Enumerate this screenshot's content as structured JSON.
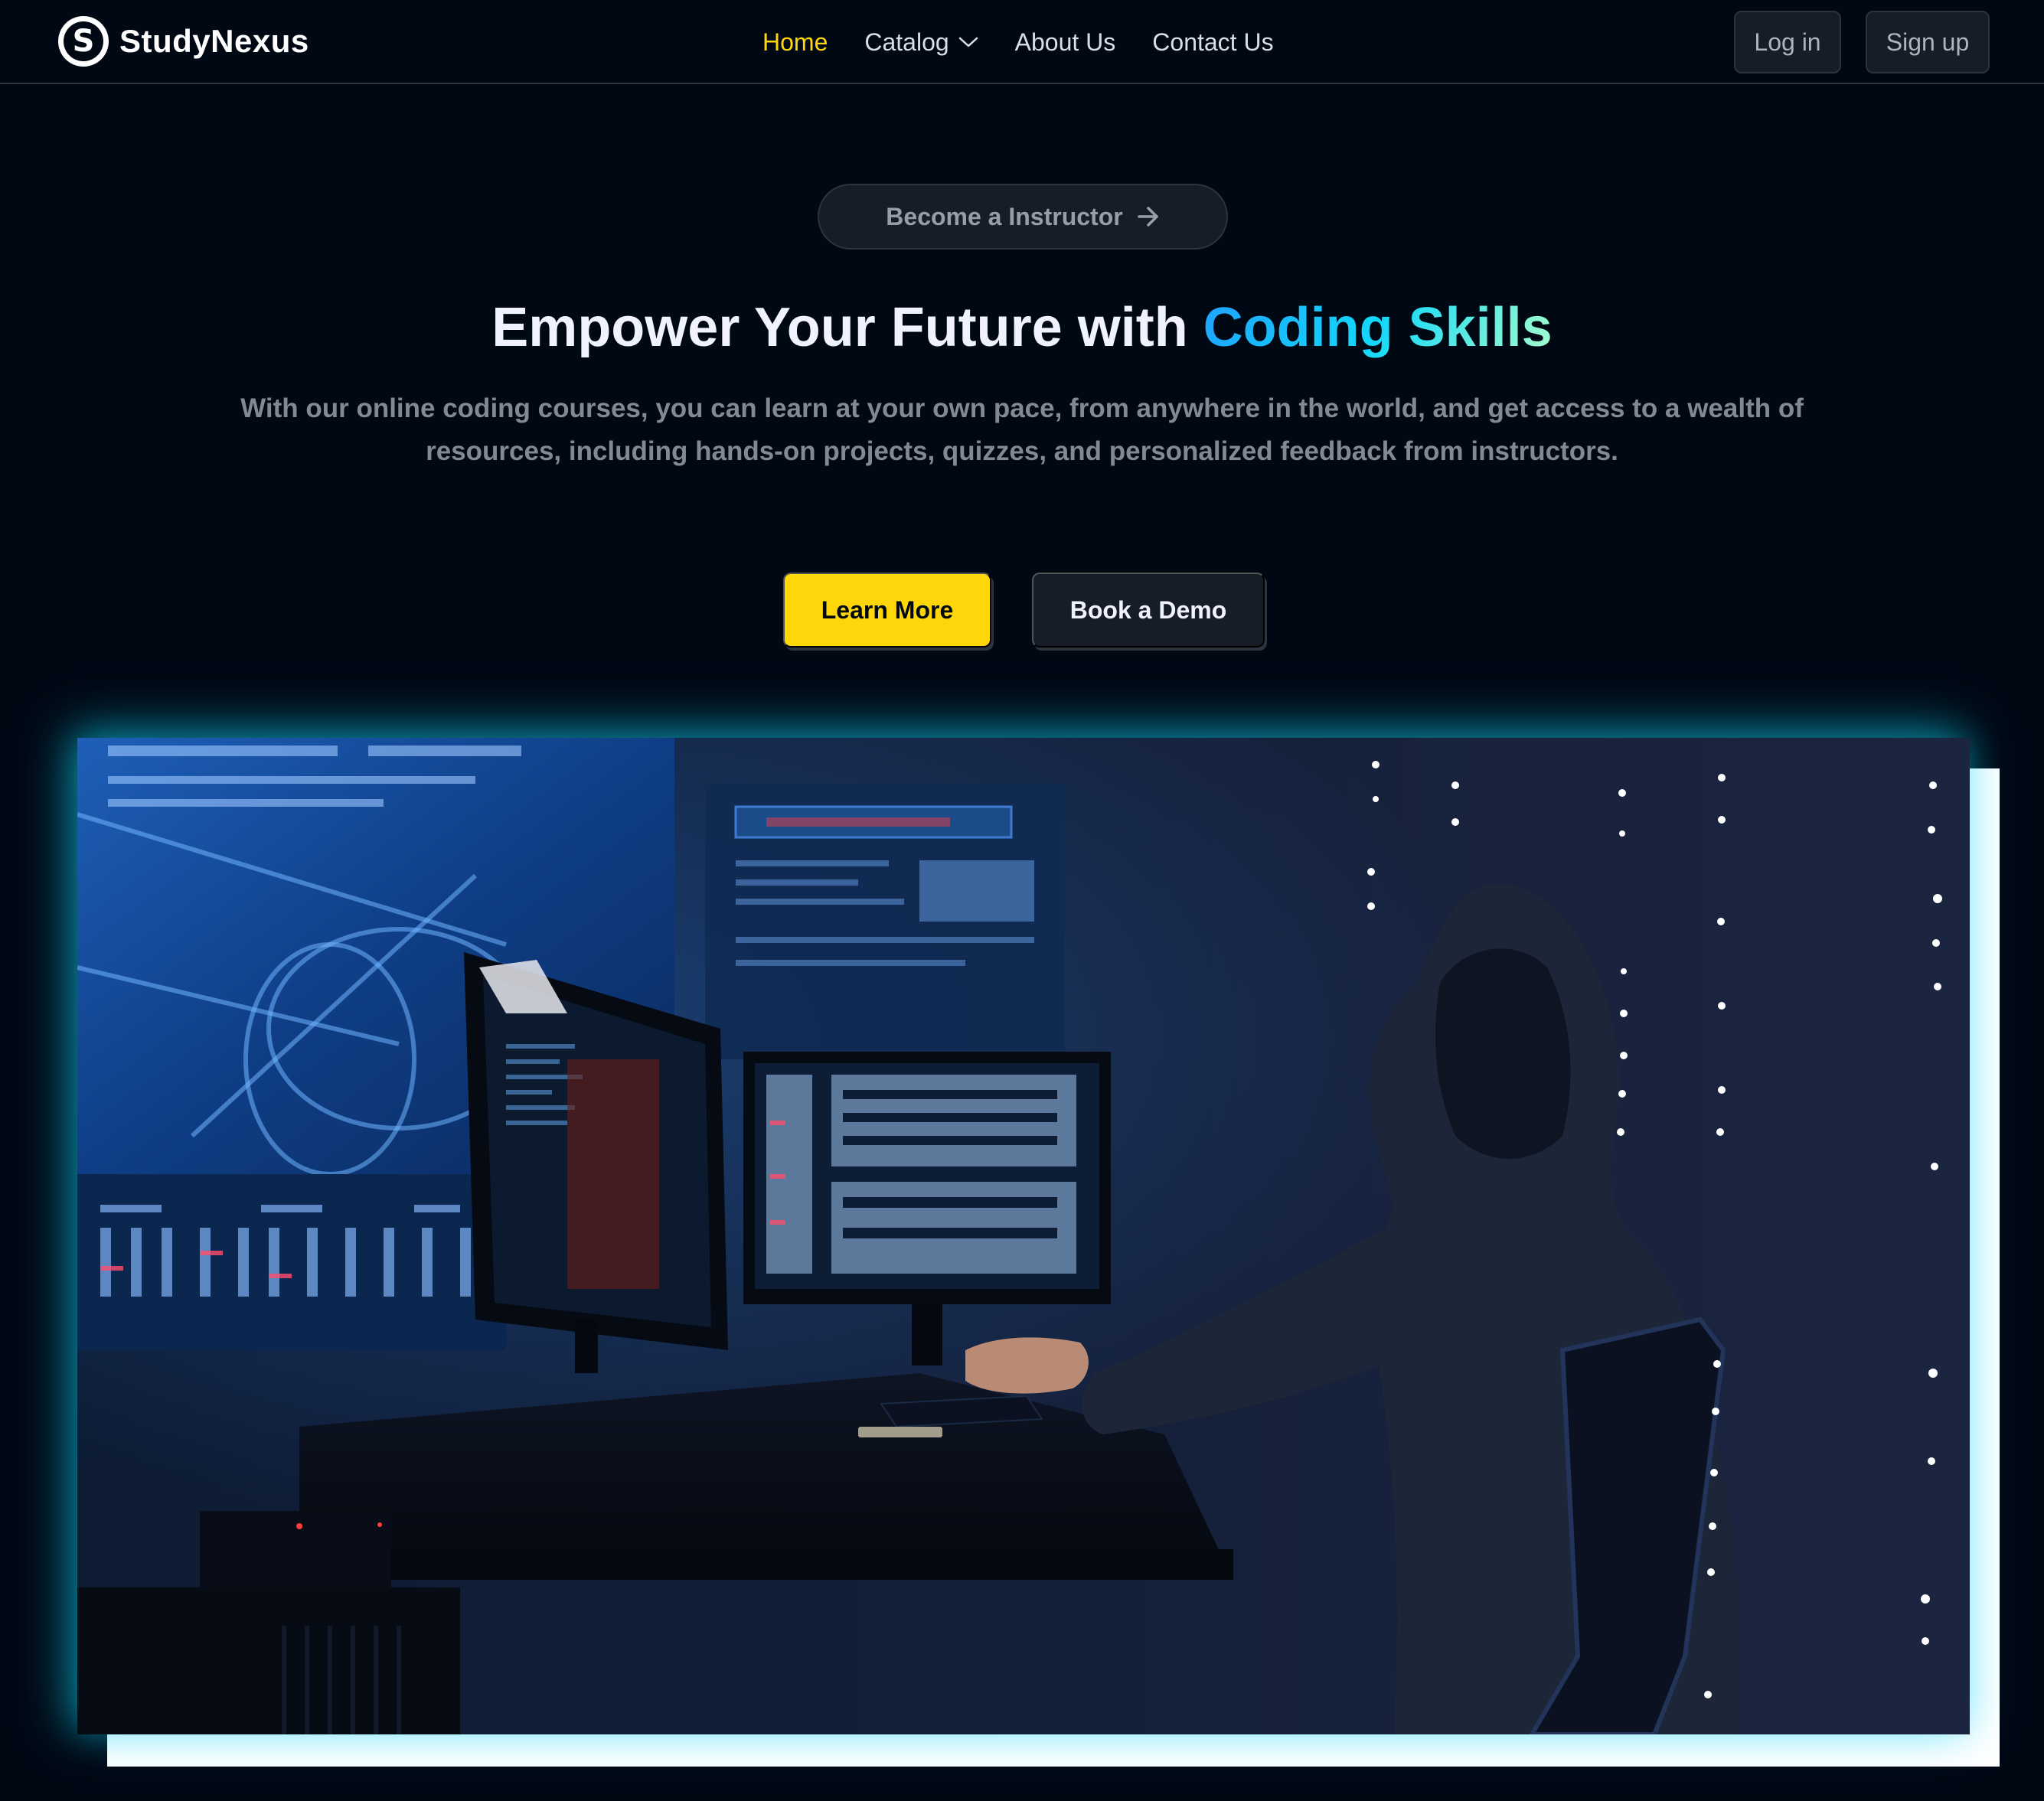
{
  "brand": {
    "logo_letter": "S",
    "name": "StudyNexus"
  },
  "nav": {
    "links": [
      {
        "label": "Home",
        "active": true
      },
      {
        "label": "Catalog",
        "dropdown": true
      },
      {
        "label": "About Us"
      },
      {
        "label": "Contact Us"
      }
    ],
    "login_label": "Log in",
    "signup_label": "Sign up"
  },
  "hero": {
    "instructor_pill": "Become a Instructor",
    "headline_prefix": "Empower Your Future with ",
    "headline_highlight": "Coding Skills",
    "subtext": "With our online coding courses, you can learn at your own pace, from anywhere in the world, and get access to a wealth of resources, including hands-on projects, quizzes, and personalized feedback from instructors.",
    "primary_cta": "Learn More",
    "secondary_cta": "Book a Demo"
  },
  "colors": {
    "background": "#000814",
    "accent_yellow": "#FFD60A",
    "gradient": [
      "#1FA2FF",
      "#12D8FA",
      "#A6FFCB"
    ],
    "muted_text": "#838894"
  },
  "icons": {
    "arrow": "arrow-right-icon",
    "chevron": "chevron-down-icon"
  }
}
